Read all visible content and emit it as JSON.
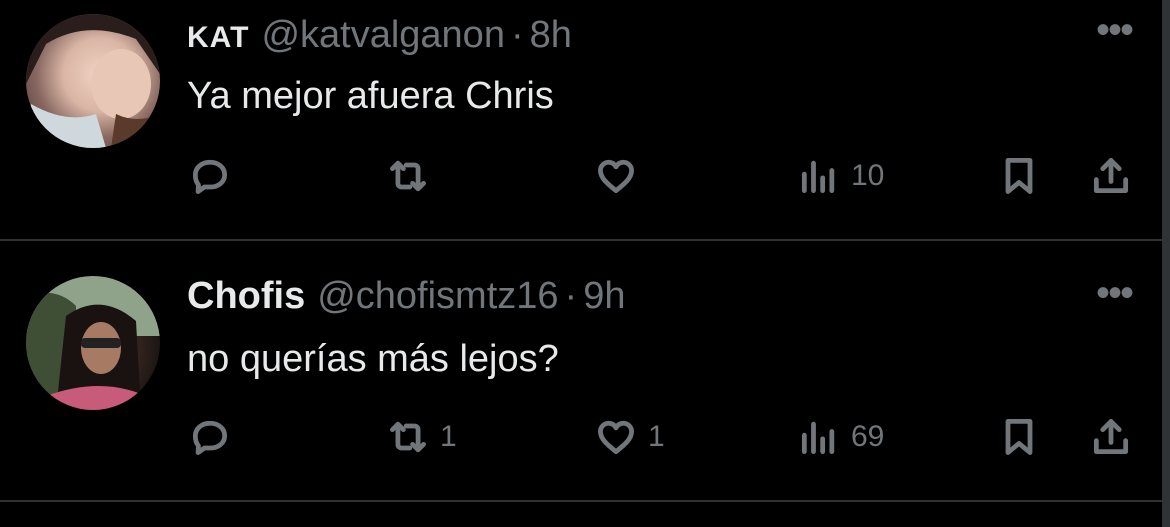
{
  "tweets": [
    {
      "display_name": "KAT",
      "handle": "@katvalganon",
      "separator": "·",
      "time": "8h",
      "text": "Ya mejor afuera Chris",
      "more": "•••",
      "stats": {
        "reply": "",
        "retweet": "",
        "like": "",
        "views": "10"
      }
    },
    {
      "display_name": "Chofis",
      "handle": "@chofismtz16",
      "separator": "·",
      "time": "9h",
      "text": "no querías más lejos?",
      "more": "•••",
      "stats": {
        "reply": "",
        "retweet": "1",
        "like": "1",
        "views": "69"
      }
    }
  ],
  "icons": {
    "reply": "reply-icon",
    "retweet": "retweet-icon",
    "like": "heart-icon",
    "views": "views-icon",
    "bookmark": "bookmark-icon",
    "share": "share-icon",
    "more": "more-icon"
  },
  "colors": {
    "background": "#000000",
    "text": "#e7e9ea",
    "secondary": "#71767b",
    "divider": "#2f3336"
  }
}
